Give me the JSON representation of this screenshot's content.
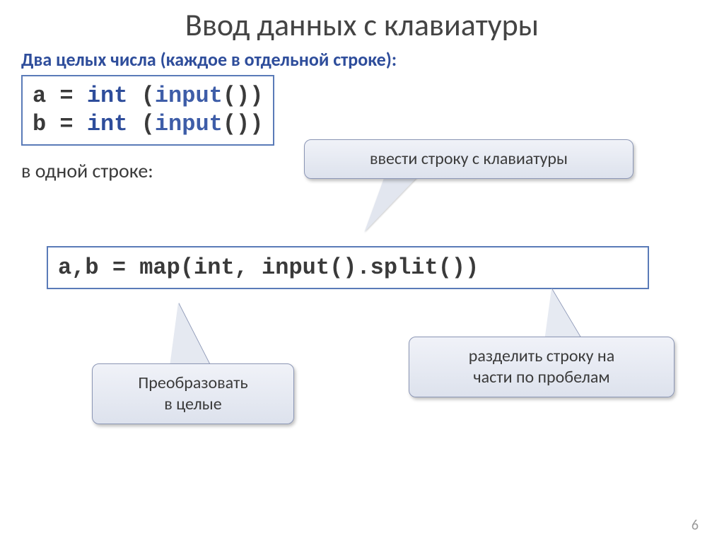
{
  "title": "Ввод данных с клавиатуры",
  "subtitle": "Два целых числа (каждое в отдельной строке):",
  "code1_line1": {
    "a": "a = ",
    "b": "int",
    "c": " (",
    "d": "input",
    "e": "())"
  },
  "code1_line2": {
    "a": "b = ",
    "b": "int",
    "c": " (",
    "d": "input",
    "e": "())"
  },
  "note": "в одной строке:",
  "code2": {
    "p1": "a,b = ",
    "p2": "map",
    "p3": "(",
    "p4": "int",
    "p5": ", ",
    "p6": "input",
    "p7": "().",
    "p8": "split",
    "p9": "())"
  },
  "callout1": "ввести строку с клавиатуры",
  "callout2_l1": "Преобразовать",
  "callout2_l2": "в целые",
  "callout3_l1": "разделить строку на",
  "callout3_l2": "части по пробелам",
  "page": "6"
}
